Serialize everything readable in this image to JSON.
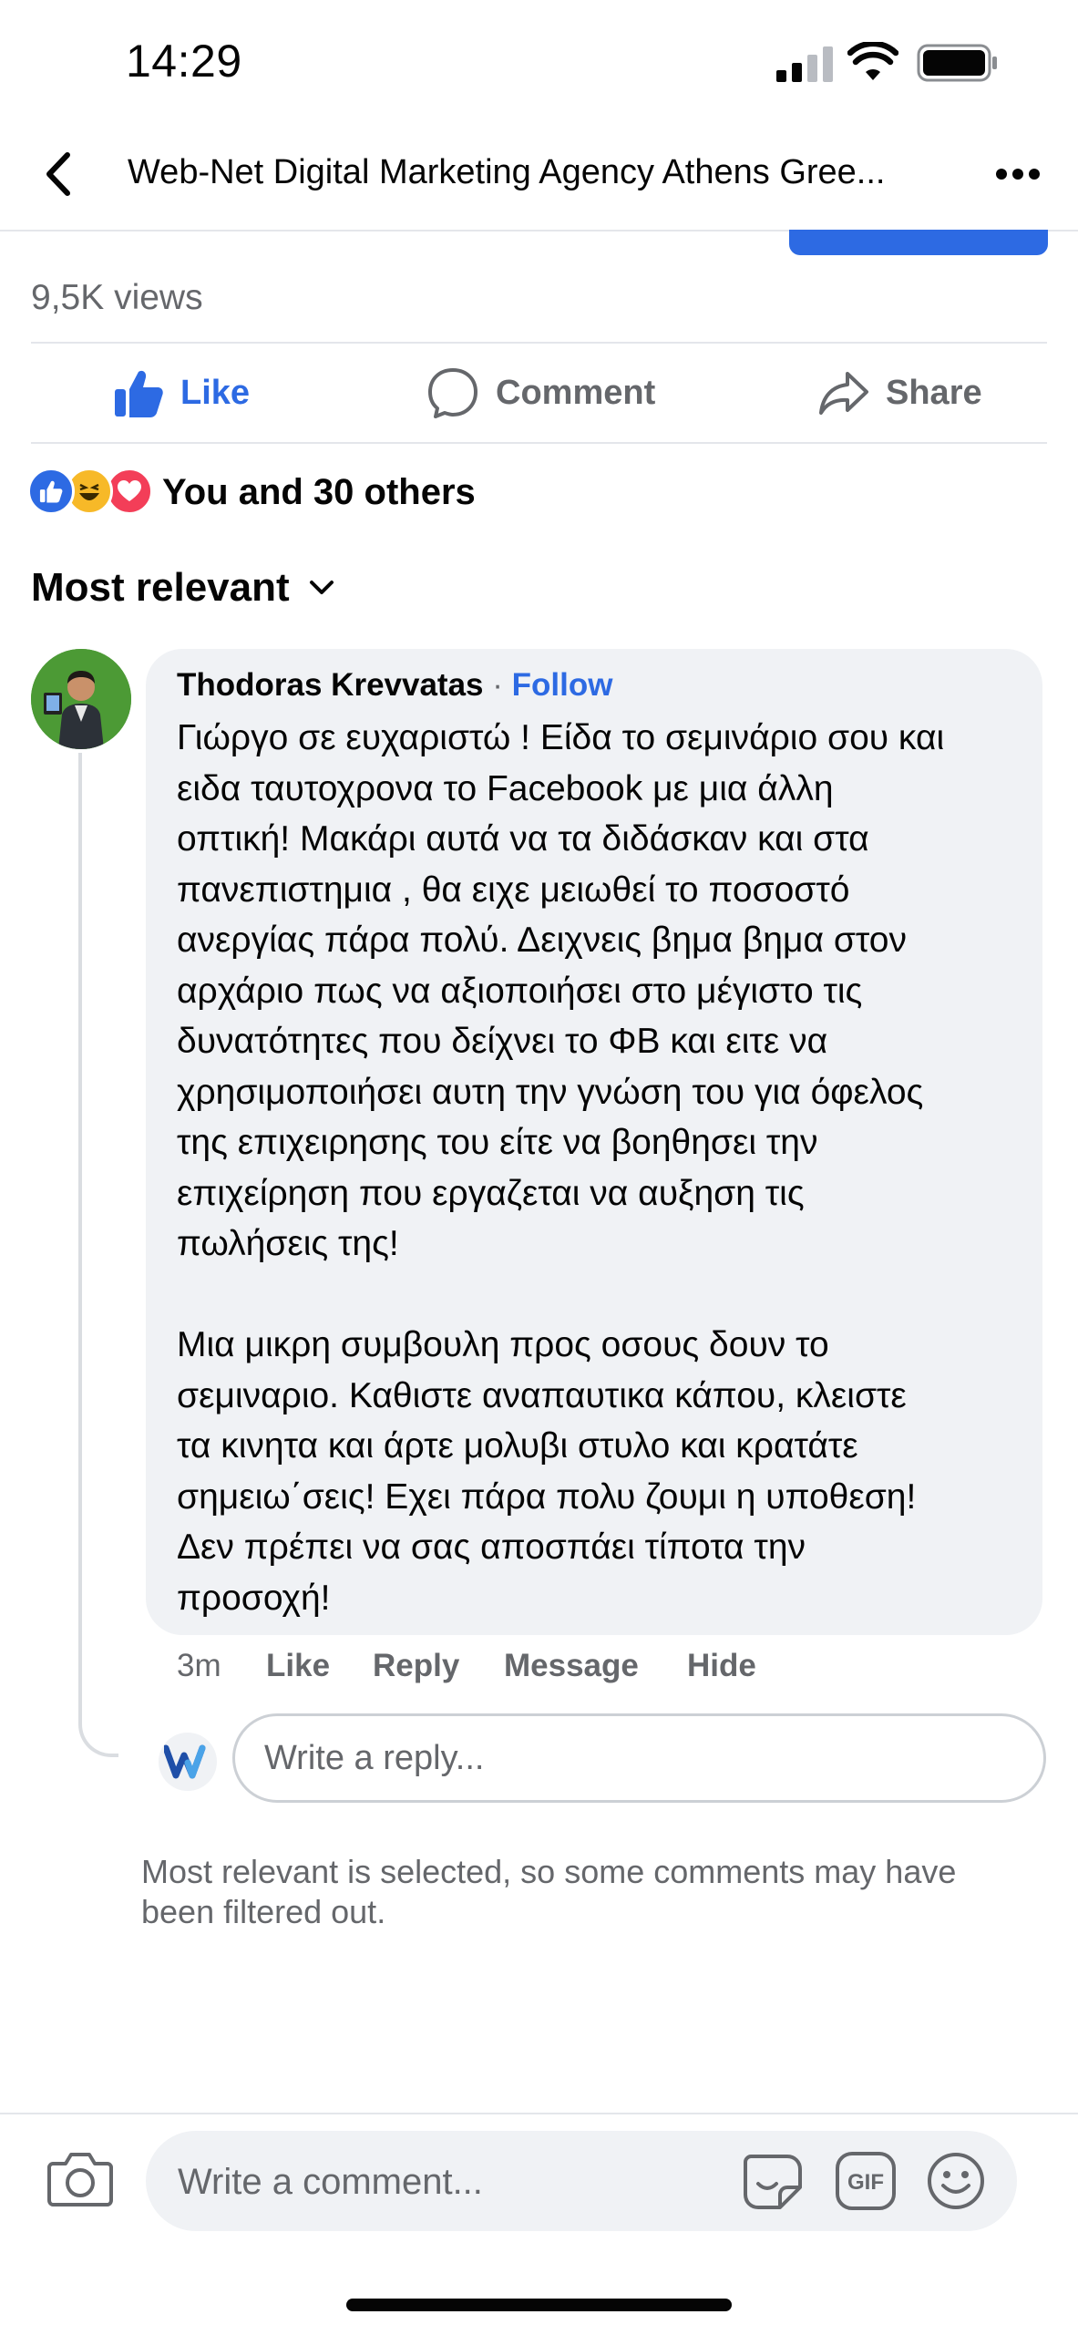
{
  "status_bar": {
    "time": "14:29"
  },
  "header": {
    "title": "Web-Net Digital Marketing Agency Athens Gree..."
  },
  "post": {
    "views": "9,5K views",
    "actions": {
      "like": "Like",
      "comment": "Comment",
      "share": "Share"
    },
    "reactions_text": "You and 30 others"
  },
  "comments_sort": {
    "label": "Most relevant"
  },
  "comment": {
    "author": "Thodoras Krevvatas",
    "separator": "·",
    "follow_label": "Follow",
    "text": "Γιώργο σε ευχαριστώ ! Είδα το σεμινάριο σου και\nειδα ταυτοχρονα το Facebook με μια άλλη\nοπτική! Μακάρι αυτά να τα διδάσκαν και στα\nπανεπιστημια , θα ειχε μειωθεί το ποσοστό\nανεργίας πάρα πολύ. Δειχνεις βημα βημα στον\nαρχάριο πως να αξιοποιήσει στο μέγιστο τις\nδυνατότητες που δείχνει το ΦΒ και ειτε να\nχρησιμοποιήσει αυτη την γνώση του για όφελος\nτης επιχειρησης του είτε να βοηθησει την\nεπιχείρηση που εργαζεται να αυξηση τις\nπωλήσεις της!\n\nΜια μικρη συμβουλη προς οσους δουν το\nσεμιναριο. Καθιστε αναπαυτικα κάπου, κλειστε\nτα κινητα και άρτε μολυβι στυλο και κρατάτε\nσημειω΄σεις! Εχει πάρα πολυ ζουμι η υποθεση!\nΔεν πρέπει να σας αποσπάει τίποτα την\nπροσοχή!",
    "time_ago": "3m",
    "actions": {
      "like": "Like",
      "reply": "Reply",
      "message": "Message",
      "hide": "Hide"
    }
  },
  "reply": {
    "placeholder": "Write a reply..."
  },
  "filter_note": "Most relevant is selected, so some comments may have been filtered out.",
  "composer": {
    "placeholder": "Write a comment..."
  },
  "icons": {
    "back": "chevron-left-icon",
    "more": "more-dots-icon",
    "camera": "camera-icon",
    "sticker": "sticker-icon",
    "gif": "gif-icon",
    "emoji": "emoji-icon"
  },
  "colors": {
    "accent": "#2d6ae3",
    "secondary_text": "#65676b",
    "bubble": "#f0f2f5"
  }
}
